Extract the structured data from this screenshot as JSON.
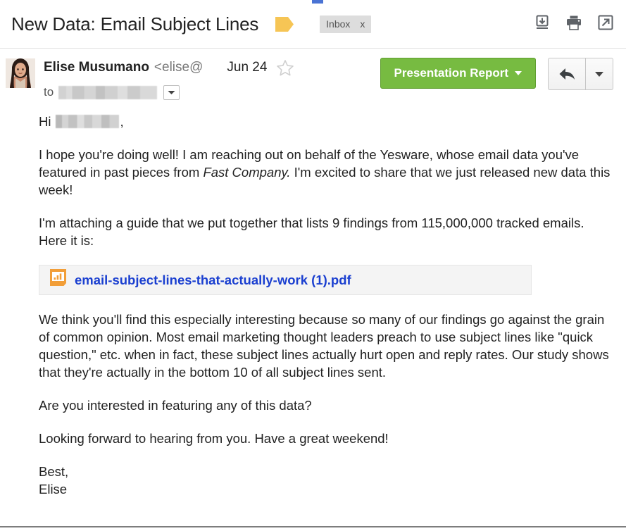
{
  "header": {
    "subject": "New Data: Email Subject Lines",
    "tag_icon": "yellow-flag-tag",
    "label": "Inbox",
    "label_close": "x",
    "actions": [
      {
        "name": "download-icon",
        "title": "Download"
      },
      {
        "name": "print-icon",
        "title": "Print"
      },
      {
        "name": "open-in-new-window-icon",
        "title": "Open in new window"
      }
    ]
  },
  "message": {
    "avatar_alt": "sender-photo",
    "sender_name": "Elise Musumano",
    "sender_email": "<elise@",
    "date": "Jun 24",
    "star_state": "unstarred",
    "to_label": "to",
    "to_value_redacted": true,
    "to_caret_icon": "chevron-down-icon",
    "report_button": "Presentation Report",
    "reply_icon": "reply-arrow-icon",
    "reply_more_icon": "chevron-down-icon"
  },
  "body": {
    "greeting_prefix": "Hi",
    "greeting_suffix": ",",
    "paragraph_1_a": "I hope you're doing well! I am reaching out on behalf of the Yesware, whose email data you've featured in past pieces from ",
    "paragraph_1_italic": "Fast Company.",
    "paragraph_1_b": " I'm excited to share that we just released new data this week!",
    "paragraph_2": "I'm attaching a guide that we put together that lists 9 findings from 115,000,000 tracked emails. Here it is:",
    "attachment_name": "email-subject-lines-that-actually-work (1).pdf",
    "attachment_icon": "pdf-chart-file-icon",
    "paragraph_3": "We think you'll find this especially interesting because so many of our findings go against the grain of common opinion. Most email marketing thought leaders preach to use subject lines like \"quick question,\" etc. when in fact, these subject lines actually hurt open and reply rates. Our study shows that they're actually in the bottom 10 of all subject lines sent.",
    "paragraph_4": "Are you interested in featuring any of this data?",
    "paragraph_5": "Looking forward to hearing from you. Have a great weekend!",
    "signoff_1": "Best,",
    "signoff_2": "Elise"
  },
  "colors": {
    "accent_green": "#77bb41",
    "link_blue": "#1a3fd0",
    "tag_yellow": "#f6c555",
    "chip_gray": "#dddddd",
    "attachment_bg": "#f4f4f4"
  }
}
